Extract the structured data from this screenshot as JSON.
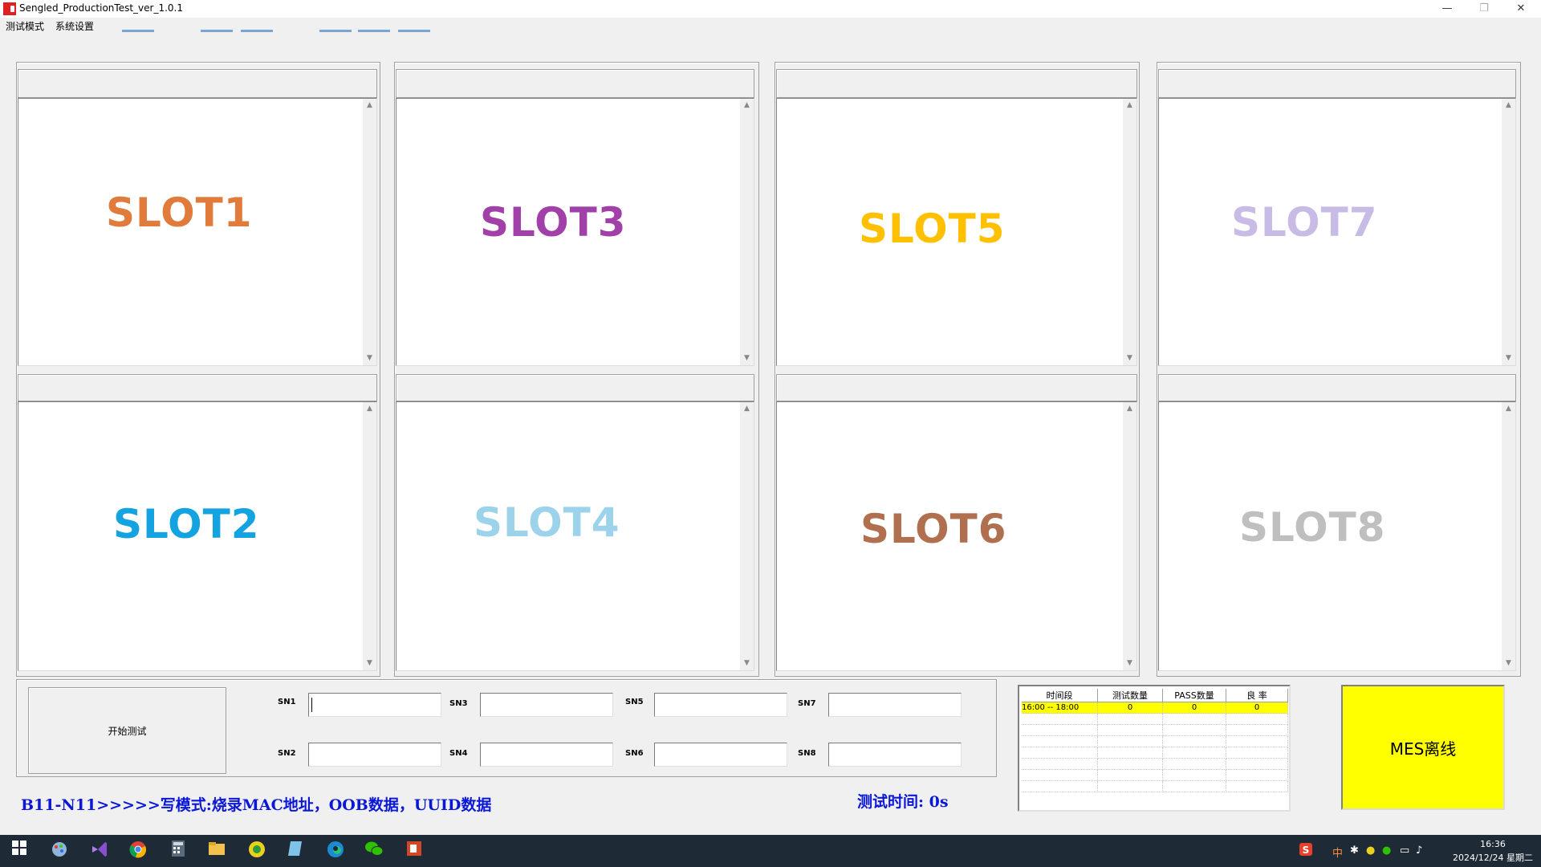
{
  "window": {
    "title": "Sengled_ProductionTest_ver_1.0.1",
    "minimize_glyph": "—",
    "maximize_glyph": "❐",
    "close_glyph": "✕"
  },
  "menu": {
    "items": [
      "测试模式",
      "系统设置"
    ]
  },
  "slots": [
    {
      "label": "SLOT1",
      "color": "#e07b3c"
    },
    {
      "label": "SLOT2",
      "color": "#13a3e0"
    },
    {
      "label": "SLOT3",
      "color": "#a040a8"
    },
    {
      "label": "SLOT4",
      "color": "#9dd3ea"
    },
    {
      "label": "SLOT5",
      "color": "#ffc000"
    },
    {
      "label": "SLOT6",
      "color": "#b07050"
    },
    {
      "label": "SLOT7",
      "color": "#c8bce6"
    },
    {
      "label": "SLOT8",
      "color": "#bfbfbf"
    }
  ],
  "controls": {
    "start_button": "开始测试",
    "sn_fields": [
      {
        "label": "SN1",
        "value": ""
      },
      {
        "label": "SN2",
        "value": ""
      },
      {
        "label": "SN3",
        "value": ""
      },
      {
        "label": "SN4",
        "value": ""
      },
      {
        "label": "SN5",
        "value": ""
      },
      {
        "label": "SN6",
        "value": ""
      },
      {
        "label": "SN7",
        "value": ""
      },
      {
        "label": "SN8",
        "value": ""
      }
    ]
  },
  "status": {
    "mode_text": "B11-N11>>>>>写模式:烧录MAC地址，OOB数据，UUID数据",
    "test_time": "测试时间: 0s"
  },
  "stats": {
    "headers": [
      "时间段",
      "测试数量",
      "PASS数量",
      "良  率"
    ],
    "rows": [
      [
        "16:00 -- 18:00",
        "0",
        "0",
        "0"
      ]
    ]
  },
  "mes": {
    "label": "MES离线",
    "color": "#ffff00"
  },
  "taskbar": {
    "icons": [
      "windows-icon",
      "paint-icon",
      "visual-studio-icon",
      "chrome-icon",
      "calculator-icon",
      "file-explorer-icon",
      "app-icon",
      "notepad-icon",
      "edge-icon",
      "wechat-icon",
      "powerpoint-icon"
    ],
    "tray": {
      "ime": "中",
      "time": "16:36",
      "date": "2024/12/24 星期二"
    }
  }
}
